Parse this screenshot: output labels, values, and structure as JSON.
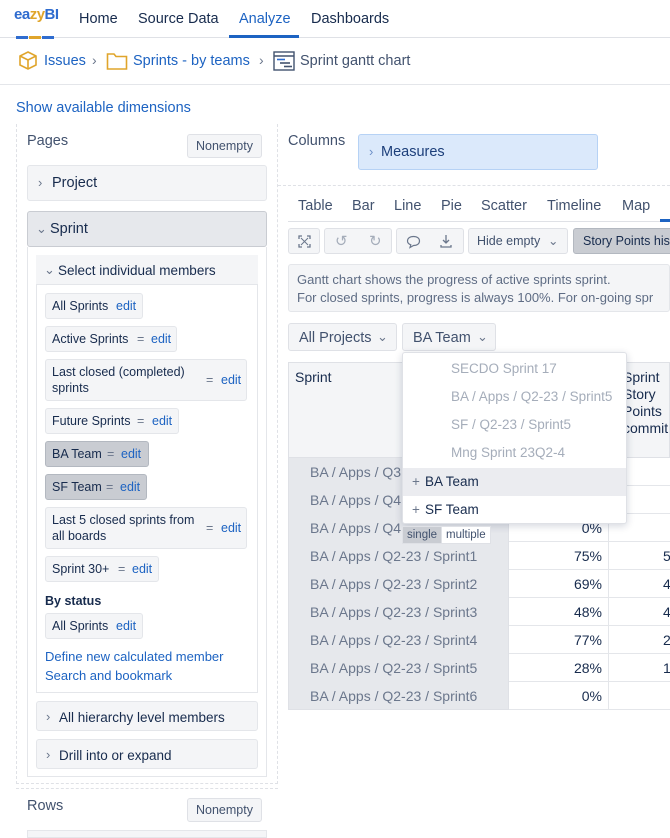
{
  "topnav": {
    "logo": {
      "e": "ea",
      "z": "zy",
      "b": "BI"
    },
    "items": [
      "Home",
      "Source Data",
      "Analyze",
      "Dashboards"
    ],
    "active": "Analyze"
  },
  "breadcrumb": {
    "items": [
      "Issues",
      "Sprints - by teams",
      "Sprint gantt chart"
    ]
  },
  "show_dimensions": "Show available dimensions",
  "pages": {
    "title": "Pages",
    "nonempty": "Nonempty",
    "project_label": "Project",
    "sprint_label": "Sprint",
    "select_members_label": "Select individual members",
    "members": [
      {
        "name": "All Sprints",
        "edit": "edit"
      },
      {
        "name": "Active Sprints",
        "eq": "=",
        "edit": "edit"
      },
      {
        "name1": "Last closed (completed)",
        "name2": "sprints",
        "eq": "=",
        "edit": "edit"
      },
      {
        "name": "Future Sprints",
        "eq": "=",
        "edit": "edit"
      },
      {
        "name": "BA Team",
        "eq": "=",
        "edit": "edit"
      },
      {
        "name": "SF Team",
        "eq": "=",
        "edit": "edit"
      },
      {
        "name1": "Last 5 closed sprints from",
        "name2": "all boards",
        "eq": "=",
        "edit": "edit"
      },
      {
        "name": "Sprint 30+",
        "eq": "=",
        "edit": "edit"
      }
    ],
    "by_status": "By status",
    "status_member": {
      "name": "All Sprints",
      "edit": "edit"
    },
    "define_new": "Define new calculated member",
    "search_bookmark": "Search and bookmark",
    "all_hierarchy": "All hierarchy level members",
    "drill": "Drill into or expand"
  },
  "rows": {
    "title": "Rows",
    "nonempty": "Nonempty"
  },
  "columns": {
    "title": "Columns",
    "measures": "Measures"
  },
  "viewtabs": [
    "Table",
    "Bar",
    "Line",
    "Pie",
    "Scatter",
    "Timeline",
    "Map"
  ],
  "toolbar": {
    "hide_empty": "Hide empty",
    "story_points": "Story Points his"
  },
  "info": {
    "line1": "Gantt chart shows the progress of active sprints sprint.",
    "line2": "For closed sprints, progress is always 100%. For on-going spr"
  },
  "filters": {
    "projects": "All Projects",
    "team": "BA Team"
  },
  "table": {
    "header_sprint": "Sprint",
    "header_col3": "Sprint\nStory\nPoints\ncommit",
    "rows": [
      {
        "sprint": "BA / Apps / Q3",
        "value": "",
        "col3": ""
      },
      {
        "sprint": "BA / Apps / Q4",
        "value": "",
        "col3": ""
      },
      {
        "sprint": "BA / Apps / Q4",
        "value": "0%",
        "col3": ""
      },
      {
        "sprint": "BA / Apps / Q2-23 / Sprint1",
        "value": "75%",
        "col3": "5"
      },
      {
        "sprint": "BA / Apps / Q2-23 / Sprint2",
        "value": "69%",
        "col3": "4"
      },
      {
        "sprint": "BA / Apps / Q2-23 / Sprint3",
        "value": "48%",
        "col3": "4"
      },
      {
        "sprint": "BA / Apps / Q2-23 / Sprint4",
        "value": "77%",
        "col3": "2"
      },
      {
        "sprint": "BA / Apps / Q2-23 / Sprint5",
        "value": "28%",
        "col3": "1"
      },
      {
        "sprint": "BA / Apps / Q2-23 / Sprint6",
        "value": "0%",
        "col3": ""
      }
    ]
  },
  "dropdown": {
    "ghost_items": [
      "SECDO Sprint 17",
      "BA / Apps / Q2-23 / Sprint5",
      "SF / Q2-23 / Sprint5",
      "Mng Sprint 23Q2-4"
    ],
    "teams": [
      "BA Team",
      "SF Team"
    ],
    "plus": "+",
    "single": "single",
    "multiple": "multiple"
  },
  "colors": {
    "accent": "#1d63c2",
    "selected_member": "#c9ccd2",
    "measures_bg": "#dbe9fb"
  }
}
